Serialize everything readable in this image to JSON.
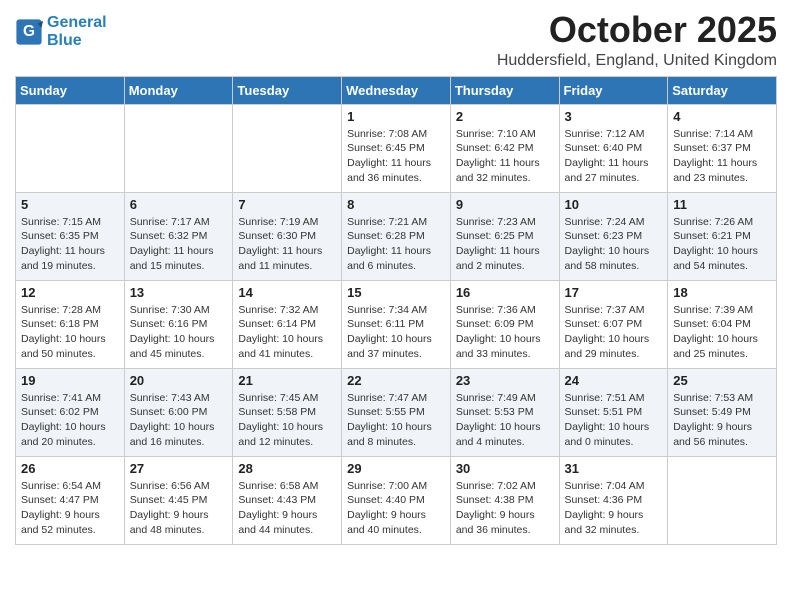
{
  "header": {
    "logo_line1": "General",
    "logo_line2": "Blue",
    "month": "October 2025",
    "location": "Huddersfield, England, United Kingdom"
  },
  "days_of_week": [
    "Sunday",
    "Monday",
    "Tuesday",
    "Wednesday",
    "Thursday",
    "Friday",
    "Saturday"
  ],
  "weeks": [
    [
      {
        "day": "",
        "info": ""
      },
      {
        "day": "",
        "info": ""
      },
      {
        "day": "",
        "info": ""
      },
      {
        "day": "1",
        "info": "Sunrise: 7:08 AM\nSunset: 6:45 PM\nDaylight: 11 hours\nand 36 minutes."
      },
      {
        "day": "2",
        "info": "Sunrise: 7:10 AM\nSunset: 6:42 PM\nDaylight: 11 hours\nand 32 minutes."
      },
      {
        "day": "3",
        "info": "Sunrise: 7:12 AM\nSunset: 6:40 PM\nDaylight: 11 hours\nand 27 minutes."
      },
      {
        "day": "4",
        "info": "Sunrise: 7:14 AM\nSunset: 6:37 PM\nDaylight: 11 hours\nand 23 minutes."
      }
    ],
    [
      {
        "day": "5",
        "info": "Sunrise: 7:15 AM\nSunset: 6:35 PM\nDaylight: 11 hours\nand 19 minutes."
      },
      {
        "day": "6",
        "info": "Sunrise: 7:17 AM\nSunset: 6:32 PM\nDaylight: 11 hours\nand 15 minutes."
      },
      {
        "day": "7",
        "info": "Sunrise: 7:19 AM\nSunset: 6:30 PM\nDaylight: 11 hours\nand 11 minutes."
      },
      {
        "day": "8",
        "info": "Sunrise: 7:21 AM\nSunset: 6:28 PM\nDaylight: 11 hours\nand 6 minutes."
      },
      {
        "day": "9",
        "info": "Sunrise: 7:23 AM\nSunset: 6:25 PM\nDaylight: 11 hours\nand 2 minutes."
      },
      {
        "day": "10",
        "info": "Sunrise: 7:24 AM\nSunset: 6:23 PM\nDaylight: 10 hours\nand 58 minutes."
      },
      {
        "day": "11",
        "info": "Sunrise: 7:26 AM\nSunset: 6:21 PM\nDaylight: 10 hours\nand 54 minutes."
      }
    ],
    [
      {
        "day": "12",
        "info": "Sunrise: 7:28 AM\nSunset: 6:18 PM\nDaylight: 10 hours\nand 50 minutes."
      },
      {
        "day": "13",
        "info": "Sunrise: 7:30 AM\nSunset: 6:16 PM\nDaylight: 10 hours\nand 45 minutes."
      },
      {
        "day": "14",
        "info": "Sunrise: 7:32 AM\nSunset: 6:14 PM\nDaylight: 10 hours\nand 41 minutes."
      },
      {
        "day": "15",
        "info": "Sunrise: 7:34 AM\nSunset: 6:11 PM\nDaylight: 10 hours\nand 37 minutes."
      },
      {
        "day": "16",
        "info": "Sunrise: 7:36 AM\nSunset: 6:09 PM\nDaylight: 10 hours\nand 33 minutes."
      },
      {
        "day": "17",
        "info": "Sunrise: 7:37 AM\nSunset: 6:07 PM\nDaylight: 10 hours\nand 29 minutes."
      },
      {
        "day": "18",
        "info": "Sunrise: 7:39 AM\nSunset: 6:04 PM\nDaylight: 10 hours\nand 25 minutes."
      }
    ],
    [
      {
        "day": "19",
        "info": "Sunrise: 7:41 AM\nSunset: 6:02 PM\nDaylight: 10 hours\nand 20 minutes."
      },
      {
        "day": "20",
        "info": "Sunrise: 7:43 AM\nSunset: 6:00 PM\nDaylight: 10 hours\nand 16 minutes."
      },
      {
        "day": "21",
        "info": "Sunrise: 7:45 AM\nSunset: 5:58 PM\nDaylight: 10 hours\nand 12 minutes."
      },
      {
        "day": "22",
        "info": "Sunrise: 7:47 AM\nSunset: 5:55 PM\nDaylight: 10 hours\nand 8 minutes."
      },
      {
        "day": "23",
        "info": "Sunrise: 7:49 AM\nSunset: 5:53 PM\nDaylight: 10 hours\nand 4 minutes."
      },
      {
        "day": "24",
        "info": "Sunrise: 7:51 AM\nSunset: 5:51 PM\nDaylight: 10 hours\nand 0 minutes."
      },
      {
        "day": "25",
        "info": "Sunrise: 7:53 AM\nSunset: 5:49 PM\nDaylight: 9 hours\nand 56 minutes."
      }
    ],
    [
      {
        "day": "26",
        "info": "Sunrise: 6:54 AM\nSunset: 4:47 PM\nDaylight: 9 hours\nand 52 minutes."
      },
      {
        "day": "27",
        "info": "Sunrise: 6:56 AM\nSunset: 4:45 PM\nDaylight: 9 hours\nand 48 minutes."
      },
      {
        "day": "28",
        "info": "Sunrise: 6:58 AM\nSunset: 4:43 PM\nDaylight: 9 hours\nand 44 minutes."
      },
      {
        "day": "29",
        "info": "Sunrise: 7:00 AM\nSunset: 4:40 PM\nDaylight: 9 hours\nand 40 minutes."
      },
      {
        "day": "30",
        "info": "Sunrise: 7:02 AM\nSunset: 4:38 PM\nDaylight: 9 hours\nand 36 minutes."
      },
      {
        "day": "31",
        "info": "Sunrise: 7:04 AM\nSunset: 4:36 PM\nDaylight: 9 hours\nand 32 minutes."
      },
      {
        "day": "",
        "info": ""
      }
    ]
  ]
}
